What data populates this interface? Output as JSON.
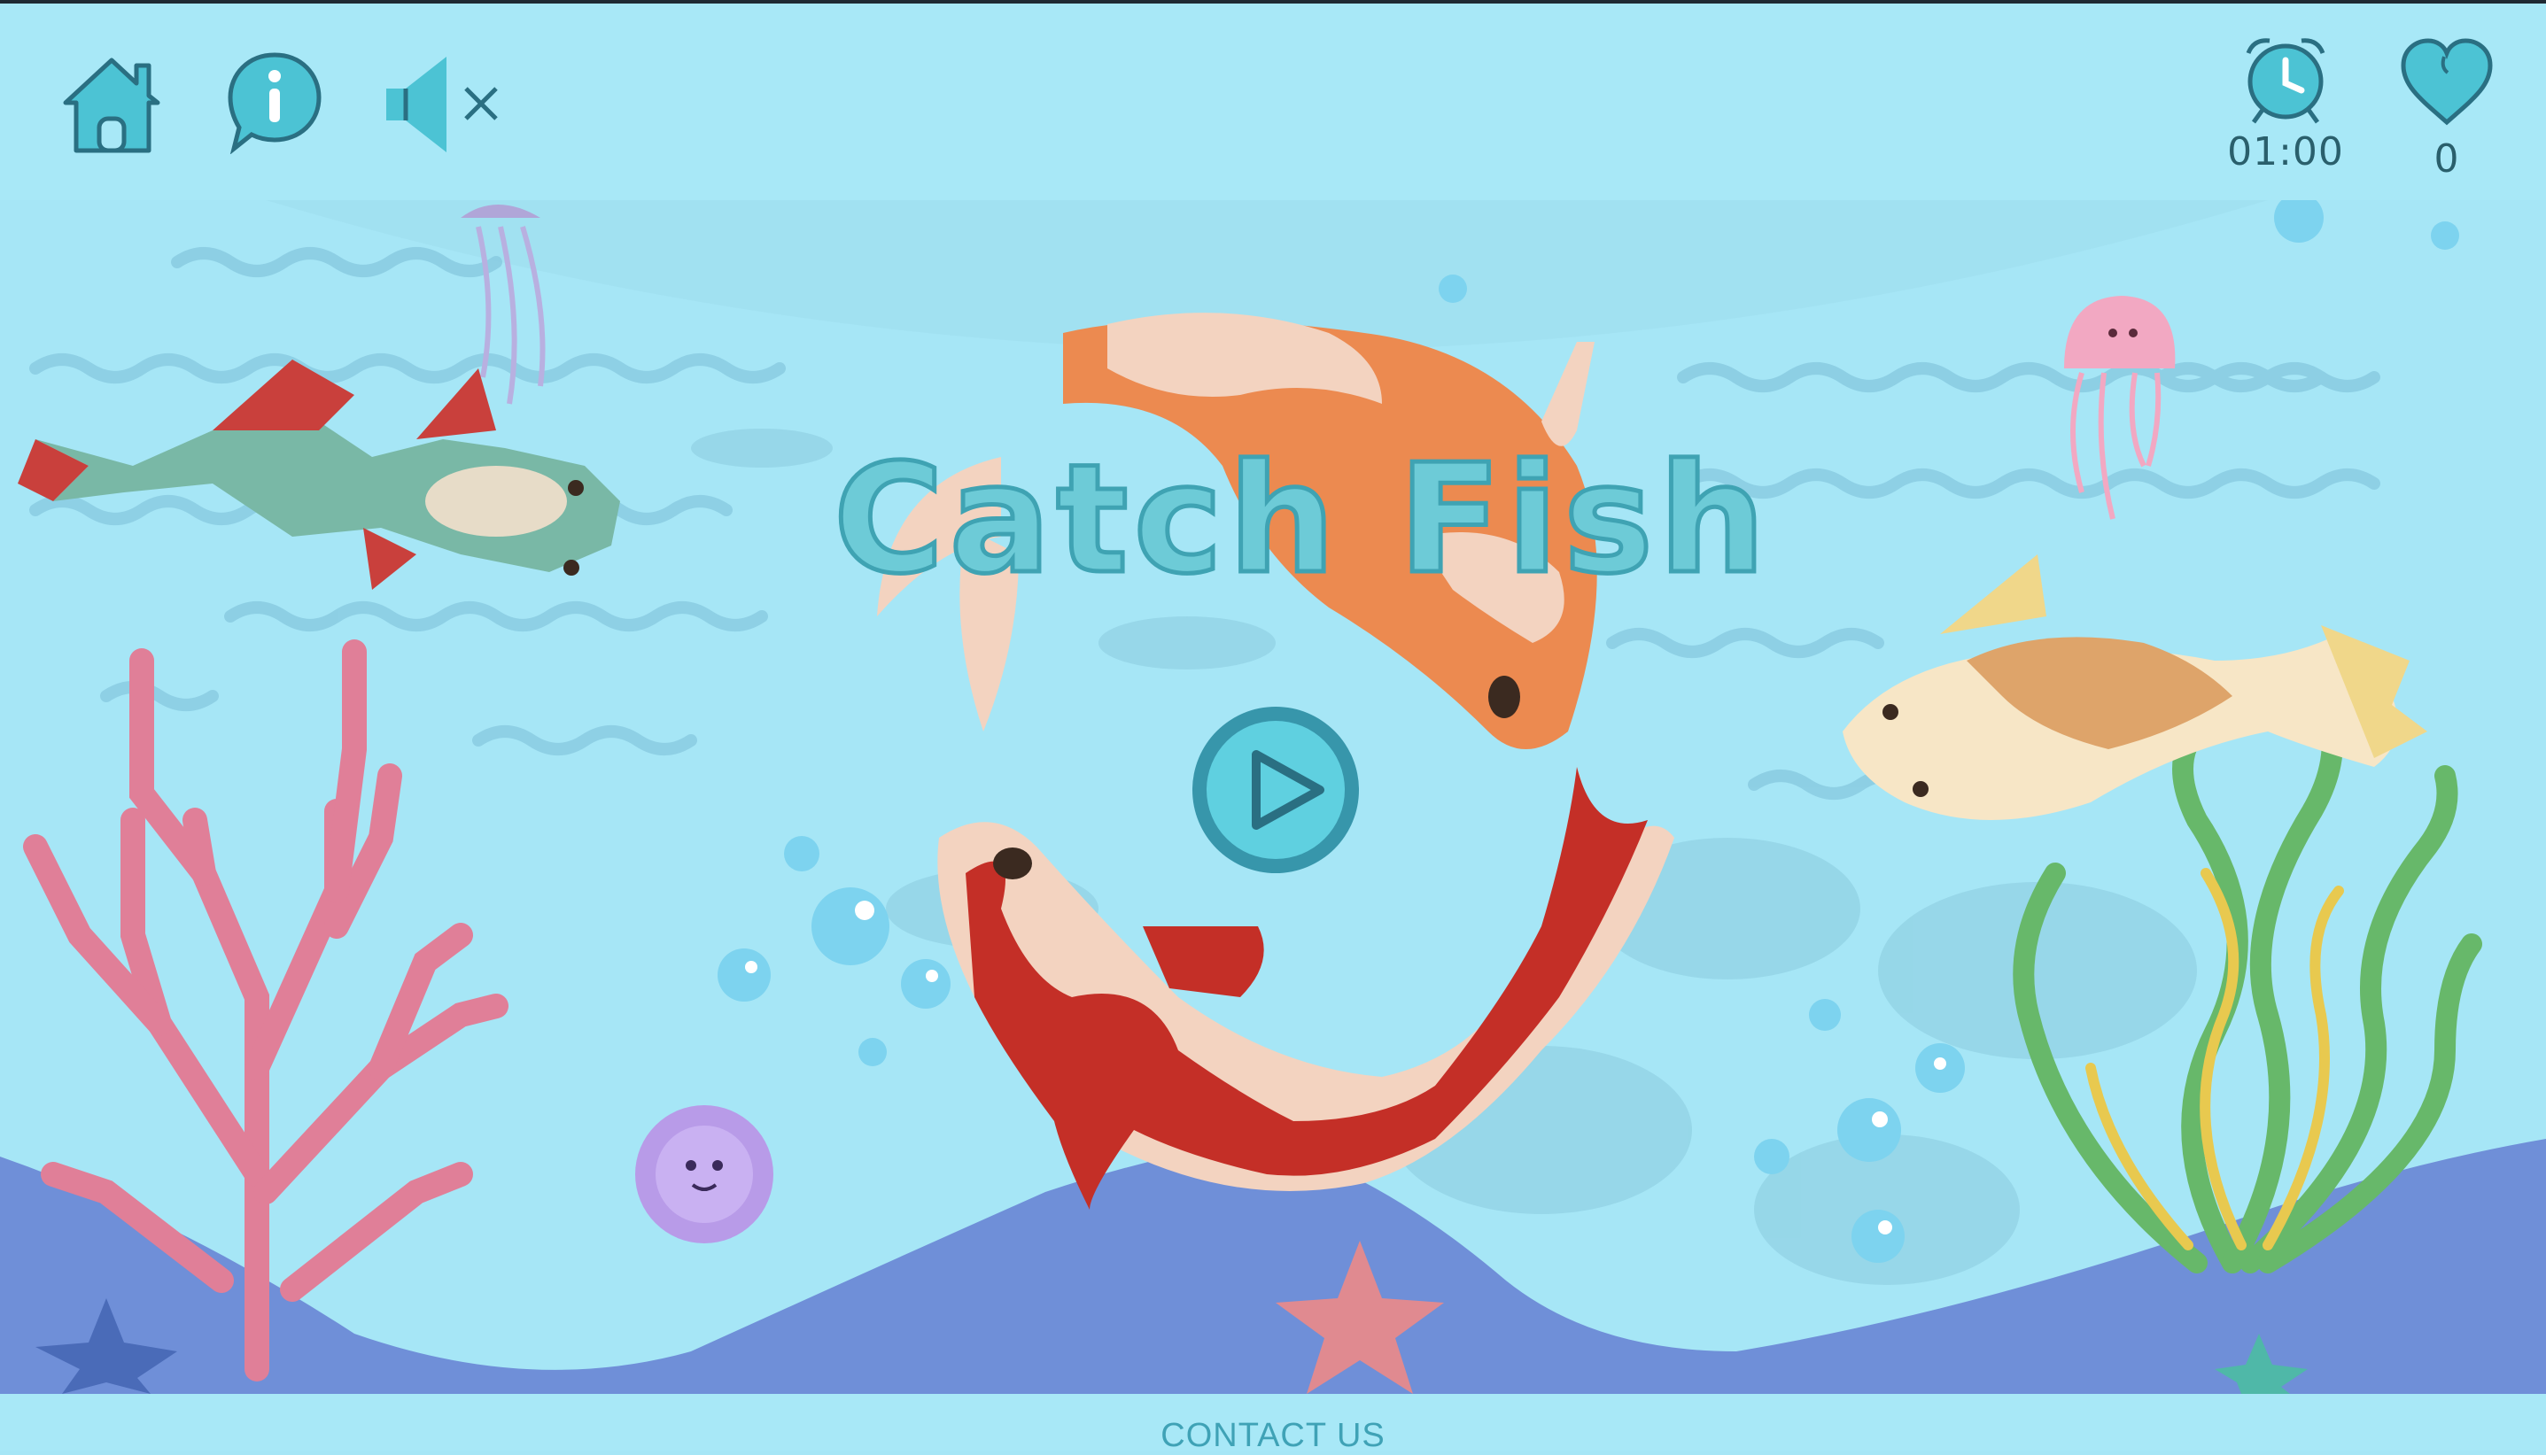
{
  "game": {
    "title": "Catch Fish",
    "timer": "01:00",
    "hearts": "0"
  },
  "controls": {
    "home_icon": "home-icon",
    "info_icon": "info-icon",
    "sound_icon": "sound-muted-icon",
    "play_icon": "play-icon",
    "clock_icon": "alarm-clock-icon",
    "heart_icon": "heart-icon"
  },
  "footer": {
    "contact": "CONTACT US"
  },
  "colors": {
    "water": "#a6e6f6",
    "accent": "#3fa2b6",
    "icon": "#49bfd1",
    "seabed": "#6f8fd8"
  }
}
